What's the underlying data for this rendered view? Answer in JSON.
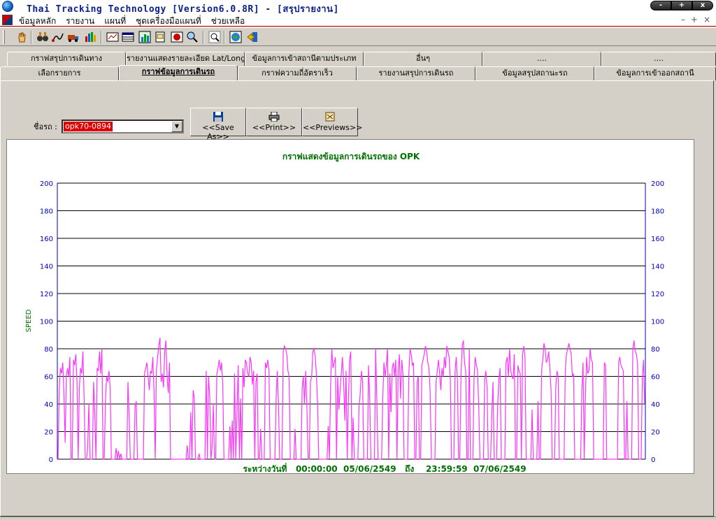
{
  "window": {
    "title": "Thai Tracking Technology [Version6.0.8R] - [สรุปรายงาน]",
    "buttons": [
      "-",
      "+",
      "x"
    ]
  },
  "menu": {
    "items": [
      "ข้อมูลหลัก",
      "รายงาน",
      "แผนที่",
      "ชุดเครื่องมือแผนที่",
      "ช่วยเหลือ"
    ],
    "mdi_buttons": [
      "–",
      "+",
      "×"
    ]
  },
  "toolbar": {
    "icons": [
      "hand-icon",
      "binoculars-icon",
      "route-icon",
      "truck-icon",
      "stats-icon",
      "chart-icon",
      "table-icon",
      "bar-chart-icon",
      "report-icon",
      "map-icon",
      "search-icon",
      "zoom-icon",
      "globe-icon",
      "exit-icon"
    ]
  },
  "tabs": {
    "top": [
      "กราฟสรุปการเดินทาง",
      "รายงานแสดงรายละเอียด Lat/Long",
      "ข้อมูลการเข้าสถานีตามประเภท",
      "อื่นๆ",
      "....",
      "...."
    ],
    "bottom": [
      "เลือกรายการ",
      "กราฟข้อมูลการเดินรถ",
      "กราฟความถี่อัตราเร็ว",
      "รายงานสรุปการเดินรถ",
      "ข้อมูลสรุปสถานะรถ",
      "ข้อมูลการเข้าออกสถานี"
    ],
    "active": "กราฟข้อมูลการเดินรถ"
  },
  "vehicle": {
    "label": "ชื่อรถ :",
    "value": "opk70-0894"
  },
  "actions": {
    "save_as": "<<Save As>>",
    "print": "<<Print>>",
    "previews": "<<Previews>>"
  },
  "chart_data": {
    "type": "line",
    "title": "กราฟแสดงข้อมูลการเดินรถของ OPK",
    "ylabel": "SPEED",
    "xlabel": "ระหว่างวันที่   00:00:00  05/06/2549   ถึง    23:59:59  07/06/2549",
    "ylim": [
      0,
      200
    ],
    "yticks": [
      0,
      20,
      40,
      60,
      80,
      100,
      120,
      140,
      160,
      180,
      200
    ],
    "grid": true,
    "series": [
      {
        "values": [
          0,
          50,
          66,
          62,
          70,
          48,
          12,
          60,
          66,
          60,
          74,
          0,
          0,
          72,
          68,
          76,
          56,
          0,
          52,
          66,
          62,
          78,
          44,
          0,
          0,
          8,
          40,
          0,
          0,
          0,
          56,
          34,
          0,
          66,
          64,
          78,
          62,
          80,
          0,
          0,
          42,
          60,
          56,
          64,
          52,
          0,
          0,
          0,
          0,
          8,
          0,
          6,
          0,
          4,
          0,
          0,
          0,
          0,
          0,
          56,
          32,
          0,
          0,
          0,
          0,
          38,
          42,
          0,
          0,
          0,
          0,
          0,
          0,
          62,
          66,
          70,
          60,
          50,
          64,
          62,
          74,
          48,
          0,
          64,
          74,
          82,
          88,
          56,
          62,
          52,
          78,
          86,
          60,
          48,
          70,
          0,
          0,
          0,
          0,
          0,
          0,
          0,
          0,
          0,
          0,
          0,
          0,
          0,
          0,
          10,
          0,
          0,
          34,
          0,
          50,
          44,
          0,
          0,
          0,
          4,
          0,
          0,
          0,
          0,
          0,
          64,
          0,
          60,
          46,
          0,
          8,
          40,
          0,
          0,
          62,
          66,
          72,
          64,
          70,
          54,
          0,
          0,
          0,
          0,
          0,
          24,
          0,
          28,
          0,
          62,
          0,
          34,
          68,
          0,
          44,
          0,
          66,
          52,
          72,
          70,
          62,
          60,
          74,
          70,
          54,
          64,
          0,
          56,
          62,
          0,
          0,
          22,
          0,
          0,
          0,
          70,
          66,
          72,
          64,
          0,
          0,
          0,
          0,
          0,
          44,
          64,
          40,
          0,
          0,
          0,
          78,
          82,
          80,
          76,
          64,
          60,
          0,
          0,
          0,
          0,
          22,
          0,
          0,
          0,
          0,
          0,
          52,
          60,
          40,
          64,
          38,
          0,
          0,
          56,
          60,
          78,
          80,
          74,
          62,
          40,
          0,
          0,
          0,
          0,
          0,
          0,
          0,
          0,
          24,
          0,
          54,
          80,
          66,
          70,
          74,
          0,
          60,
          36,
          50,
          62,
          74,
          56,
          28,
          64,
          0,
          42,
          72,
          78,
          0,
          30,
          0,
          0,
          0,
          0,
          38,
          48,
          64,
          56,
          0,
          0,
          0,
          0,
          68,
          44,
          0,
          0,
          0,
          0,
          80,
          42,
          0,
          0,
          0,
          0,
          44,
          70,
          60,
          68,
          80,
          0,
          62,
          34,
          66,
          70,
          60,
          72,
          0,
          64,
          76,
          44,
          72,
          62,
          0,
          0,
          0,
          0,
          62,
          80,
          76,
          68,
          70,
          0,
          0,
          56,
          60,
          0,
          0,
          68,
          72,
          76,
          82,
          78,
          70,
          66,
          48,
          0,
          0,
          0,
          0,
          56,
          64,
          72,
          62,
          50,
          66,
          60,
          74,
          66,
          82,
          78,
          74,
          58,
          0,
          0,
          0,
          64,
          74,
          58,
          0,
          0,
          60,
          82,
          86,
          70,
          64,
          0,
          0,
          80,
          0,
          0,
          0,
          58,
          74,
          68,
          64,
          38,
          0,
          0,
          0,
          0,
          58,
          64,
          52,
          0,
          0,
          0,
          32,
          56,
          0,
          0,
          0,
          40,
          58,
          66,
          0,
          0,
          0,
          0,
          70,
          74,
          60,
          80,
          64,
          60,
          58,
          76,
          0,
          0,
          68,
          64,
          62,
          0,
          76,
          82,
          74,
          0,
          0,
          0,
          0,
          0,
          36,
          0,
          0,
          0,
          0,
          42,
          0,
          0,
          64,
          72,
          84,
          80,
          70,
          72,
          78,
          66,
          50,
          0,
          0,
          0,
          52,
          64,
          60,
          0,
          0,
          0,
          0,
          0,
          64,
          76,
          80,
          84,
          80,
          76,
          60,
          62,
          0,
          0,
          0,
          0,
          0,
          0,
          50,
          70,
          0,
          46,
          74,
          62,
          64,
          80,
          72,
          70,
          0,
          0,
          0,
          0,
          0,
          0,
          0,
          0,
          0,
          70,
          68,
          0,
          0,
          0,
          0,
          0,
          0,
          0,
          0,
          0,
          0,
          70,
          74,
          68,
          66,
          64,
          0,
          0,
          42,
          0,
          0,
          0,
          0,
          80,
          86,
          78,
          76,
          70,
          0,
          0,
          0,
          58,
          72,
          40
        ]
      }
    ]
  }
}
